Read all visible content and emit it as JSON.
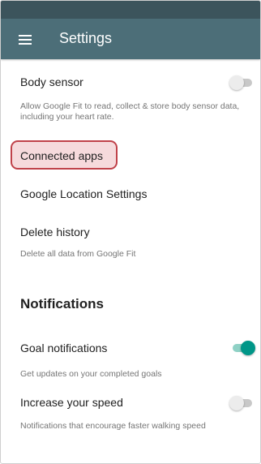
{
  "app_bar": {
    "title": "Settings",
    "menu_icon": "menu-icon"
  },
  "settings": {
    "body_sensor": {
      "title": "Body sensor",
      "subtitle": "Allow Google Fit to read, collect & store body sensor data, including your heart rate.",
      "enabled": false
    },
    "connected_apps": {
      "title": "Connected apps"
    },
    "location": {
      "title": "Google Location Settings"
    },
    "delete_history": {
      "title": "Delete history",
      "subtitle": "Delete all data from Google Fit"
    }
  },
  "notifications": {
    "header": "Notifications",
    "goal": {
      "title": "Goal notifications",
      "subtitle": "Get updates on your completed goals",
      "enabled": true
    },
    "speed": {
      "title": "Increase your speed",
      "subtitle": "Notifications that encourage faster walking speed",
      "enabled": false
    }
  },
  "colors": {
    "app_bar": "#4c6e78",
    "status_bar": "#3c545c",
    "accent": "#009688",
    "highlight_border": "#c0424a"
  }
}
